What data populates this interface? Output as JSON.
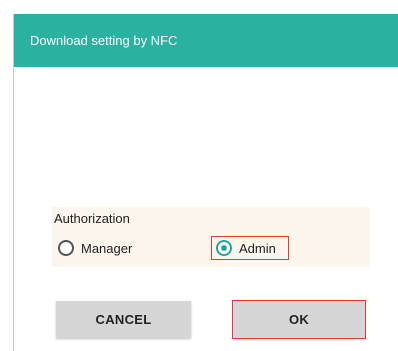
{
  "dialog": {
    "title": "Download setting by NFC"
  },
  "authorization": {
    "label": "Authorization",
    "options": [
      {
        "label": "Manager",
        "selected": false
      },
      {
        "label": "Admin",
        "selected": true
      }
    ]
  },
  "buttons": {
    "cancel_label": "CANCEL",
    "ok_label": "OK"
  },
  "colors": {
    "title_bar": "#2ab19f",
    "accent": "#26a69a",
    "highlight_outline": "#e53935"
  }
}
